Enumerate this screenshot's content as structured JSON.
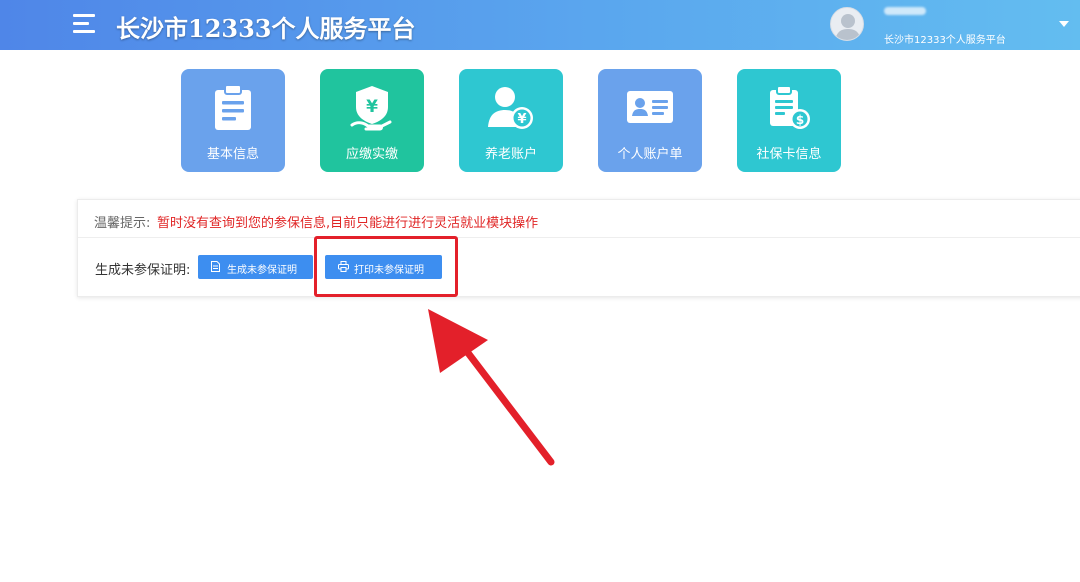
{
  "header": {
    "title": "长沙市12333个人服务平台",
    "user_org": "长沙市12333个人服务平台",
    "menu_icon": "hamburger-menu-icon",
    "avatar_icon": "user-avatar-icon",
    "caret_icon": "caret-down-icon"
  },
  "tiles": [
    {
      "label": "基本信息",
      "icon": "clipboard-document-icon",
      "color": "#6aa2ec"
    },
    {
      "label": "应缴实缴",
      "icon": "shield-yuan-icon",
      "color": "#20c49e"
    },
    {
      "label": "养老账户",
      "icon": "person-yuan-icon",
      "color": "#2ec7d1"
    },
    {
      "label": "个人账户单",
      "icon": "id-card-icon",
      "color": "#6aa2ec"
    },
    {
      "label": "社保卡信息",
      "icon": "document-dollar-icon",
      "color": "#2ec7d1"
    }
  ],
  "notice": {
    "label": "温馨提示:",
    "text": "暂时没有查询到您的参保信息,目前只能进行进行灵活就业模块操作"
  },
  "certificate": {
    "label": "生成未参保证明:",
    "generate_button": "生成未参保证明",
    "print_button": "打印未参保证明"
  },
  "colors": {
    "header_start": "#4f86e8",
    "header_end": "#63bdf0",
    "button": "#3d8ef0",
    "notice_text": "#e02525",
    "annotation": "#e3202a"
  }
}
